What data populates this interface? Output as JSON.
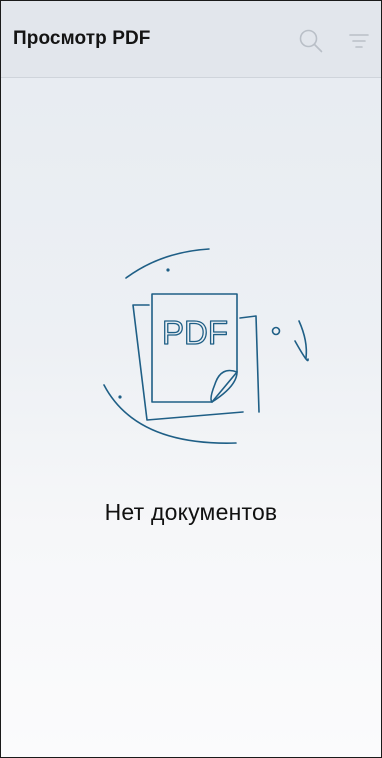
{
  "app_bar": {
    "title": "Просмотр PDF",
    "actions": [
      {
        "icon": "search-icon"
      },
      {
        "icon": "sort-icon"
      }
    ]
  },
  "empty_state": {
    "illustration": {
      "icon": "pdf-document-icon",
      "badge": "PDF"
    },
    "message": "Нет документов"
  },
  "colors": {
    "accent": "#1f5f86",
    "icon_muted": "#b9bfc7",
    "title": "#141414",
    "app_bar_bg": "#e2e6ec"
  }
}
